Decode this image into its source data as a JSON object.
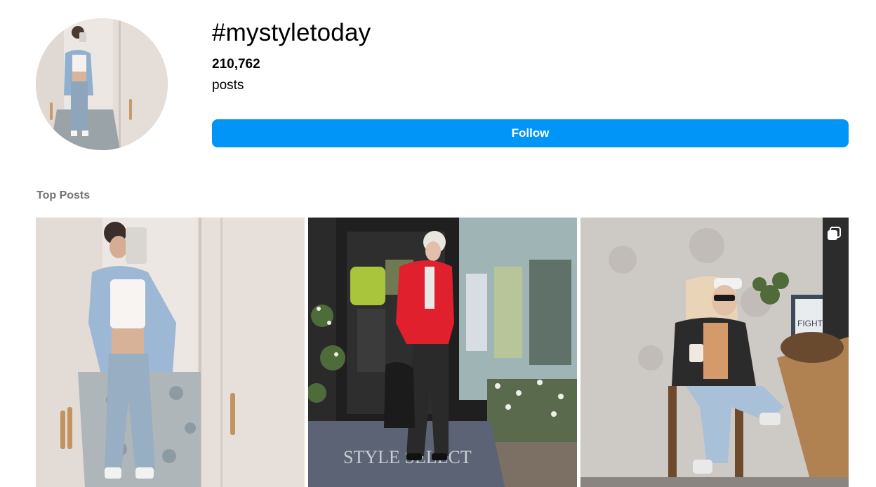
{
  "hashtag": {
    "title": "#mystyletoday",
    "post_count": "210,762",
    "post_unit": "posts",
    "follow_label": "Follow"
  },
  "top_posts": {
    "label": "Top Posts",
    "store_sign": "STYLE SELECT",
    "poster_text": "FIGHT"
  },
  "colors": {
    "accent": "#0095f6",
    "section_label": "#737373"
  },
  "icons": [
    "multiple-photos-icon"
  ]
}
